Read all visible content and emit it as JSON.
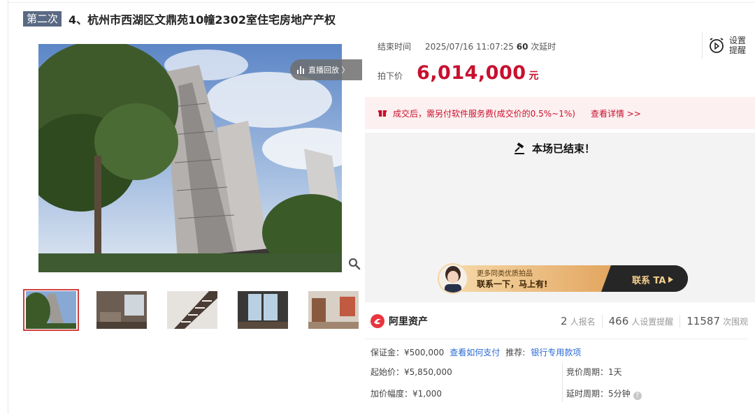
{
  "header": {
    "round_badge": "第二次",
    "title": "4、杭州市西湖区文鼎苑10幢2302室住宅房地产产权"
  },
  "gallery": {
    "replay_label": "直播回放 〉",
    "thumb_count": 5
  },
  "auction": {
    "end_time_label": "结束时间",
    "end_time_value": "2025/07/16 11:07:25",
    "delay_count": "60",
    "delay_label": "次延时",
    "remind_label": "设置提醒",
    "price_label": "拍下价",
    "price_value": "6,014,000",
    "price_unit": "元",
    "notice_text": "成交后，需另付软件服务费(成交价的0.5%~1%)",
    "notice_link": "查看详情 >>",
    "ended_text": "本场已结束！"
  },
  "banner": {
    "line1": "更多同类优质拍品",
    "line2": "联系一下，马上有!",
    "cta": "联系 TA"
  },
  "platform": {
    "name": "阿里资产",
    "signups": "2",
    "signups_label": "人报名",
    "reminders": "466",
    "reminders_label": "人设置提醒",
    "views": "11587",
    "views_label": "次围观"
  },
  "details": {
    "deposit_label": "保证金：¥500,000",
    "how_to_pay": "查看如何支付",
    "recommend_label": "推荐:",
    "recommend_link": "银行专用款项",
    "start_price": "起始价：¥5,850,000",
    "increment": "加价幅度：¥1,000",
    "bid_period": "竞价周期：1天",
    "delay_period": "延时周期：5分钟"
  },
  "colors": {
    "accent_red": "#c8102e",
    "badge_bg": "#5a6a84",
    "link_blue": "#2a6bd6"
  }
}
